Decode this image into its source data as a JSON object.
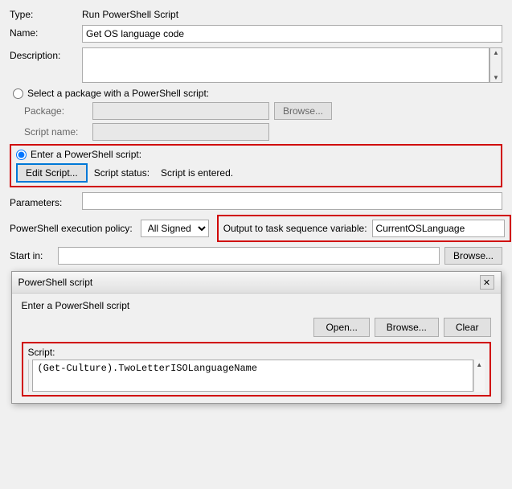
{
  "form": {
    "type_label": "Type:",
    "type_value": "Run PowerShell Script",
    "name_label": "Name:",
    "name_value": "Get OS language code",
    "description_label": "Description:",
    "description_value": "",
    "select_package_label": "Select a package with a PowerShell script:",
    "package_label": "Package:",
    "script_name_label": "Script name:",
    "enter_ps_label": "Enter a PowerShell script:",
    "edit_script_btn": "Edit Script...",
    "script_status_label": "Script status:",
    "script_status_value": "Script is entered.",
    "parameters_label": "Parameters:",
    "parameters_value": "",
    "ps_exec_label": "PowerShell execution policy:",
    "ps_exec_value": "All Signed",
    "output_label": "Output to task sequence variable:",
    "output_value": "CurrentOSLanguage",
    "start_in_label": "Start in:",
    "start_in_value": "",
    "browse_label": "Browse...",
    "browse_label2": "Browse..."
  },
  "dialog": {
    "title": "PowerShell script",
    "subtitle": "Enter a PowerShell script",
    "open_btn": "Open...",
    "browse_btn": "Browse...",
    "clear_btn": "Clear",
    "script_label": "Script:",
    "script_value": "(Get-Culture).TwoLetterISOLanguageName",
    "close_icon": "✕"
  }
}
